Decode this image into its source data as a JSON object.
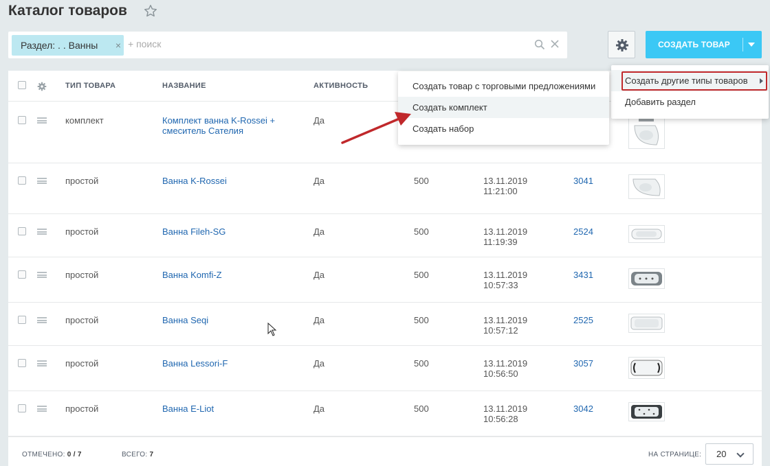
{
  "page": {
    "title": "Каталог товаров"
  },
  "filter": {
    "chip_label": "Раздел: . . Ванны",
    "chip_close": "×",
    "search_placeholder": "+ поиск"
  },
  "toolbar": {
    "create_label": "СОЗДАТЬ ТОВАР"
  },
  "columns": {
    "type": "ТИП ТОВАРА",
    "name": "НАЗВАНИЕ",
    "active": "АКТИВНОСТЬ"
  },
  "rows": [
    {
      "type": "комплект",
      "name": "Комплект ванна K-Rossei + смеситель Сателия",
      "active": "Да",
      "price": "",
      "date": "",
      "time": "",
      "id": ""
    },
    {
      "type": "простой",
      "name": "Ванна K-Rossei",
      "active": "Да",
      "price": "500",
      "date": "13.11.2019",
      "time": "11:21:00",
      "id": "3041"
    },
    {
      "type": "простой",
      "name": "Ванна Fileh-SG",
      "active": "Да",
      "price": "500",
      "date": "13.11.2019",
      "time": "11:19:39",
      "id": "2524"
    },
    {
      "type": "простой",
      "name": "Ванна Komfi-Z",
      "active": "Да",
      "price": "500",
      "date": "13.11.2019",
      "time": "10:57:33",
      "id": "3431"
    },
    {
      "type": "простой",
      "name": "Ванна Seqi",
      "active": "Да",
      "price": "500",
      "date": "13.11.2019",
      "time": "10:57:12",
      "id": "2525"
    },
    {
      "type": "простой",
      "name": "Ванна Lessori-F",
      "active": "Да",
      "price": "500",
      "date": "13.11.2019",
      "time": "10:56:50",
      "id": "3057"
    },
    {
      "type": "простой",
      "name": "Ванна E-Liot",
      "active": "Да",
      "price": "500",
      "date": "13.11.2019",
      "time": "10:56:28",
      "id": "3042"
    }
  ],
  "footer": {
    "selected_label": "ОТМЕЧЕНО:",
    "selected_value": "0 / 7",
    "total_label": "ВСЕГО:",
    "total_value": "7",
    "per_page_label": "НА СТРАНИЦЕ:",
    "per_page_value": "20"
  },
  "create_menu": {
    "items": [
      "Создать другие типы товаров",
      "Добавить раздел"
    ]
  },
  "types_submenu": {
    "items": [
      "Создать товар с торговыми предложениями",
      "Создать комплект",
      "Создать набор"
    ]
  },
  "colors": {
    "accent": "#3bc8f5",
    "link": "#2067b0",
    "annotation": "#c0282b",
    "chip": "#bce8f1"
  }
}
